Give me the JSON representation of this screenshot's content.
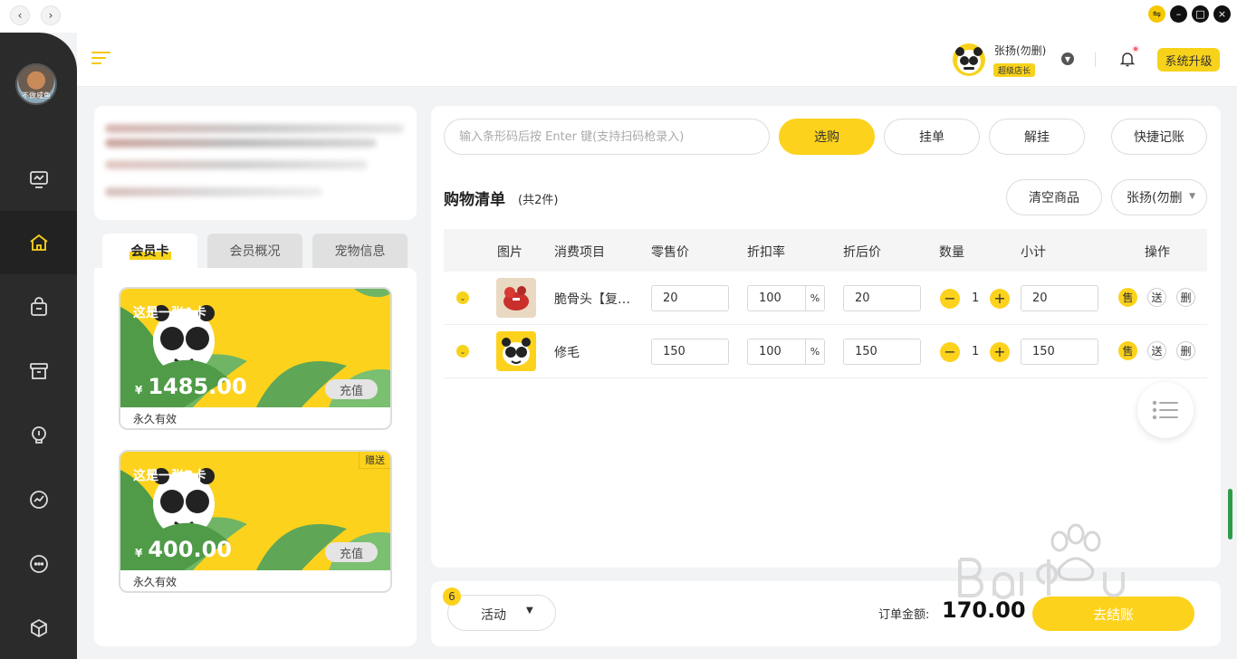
{
  "titlebar": {
    "back_glyph": "‹",
    "forward_glyph": "›",
    "controls": [
      "⇋",
      "–",
      "□",
      "×"
    ]
  },
  "sidebar": {
    "avatar_caption": "不做咸鱼",
    "items": [
      {
        "icon": "monitor-icon",
        "active": false
      },
      {
        "icon": "shop-icon",
        "active": true
      },
      {
        "icon": "bag-icon",
        "active": false
      },
      {
        "icon": "box-icon",
        "active": false
      },
      {
        "icon": "bulb-icon",
        "active": false
      },
      {
        "icon": "chart-icon",
        "active": false
      },
      {
        "icon": "chat-icon",
        "active": false
      },
      {
        "icon": "cube-icon",
        "active": false
      }
    ]
  },
  "header": {
    "user_name": "张扬(勿删)",
    "user_role": "超级店长",
    "upgrade_label": "系统升级"
  },
  "member_tabs": [
    "会员卡",
    "会员概况",
    "宠物信息"
  ],
  "cards": [
    {
      "title": "这是一张A卡",
      "currency": "¥",
      "amount": "1485.00",
      "recharge": "充值",
      "validity": "永久有效",
      "gift": ""
    },
    {
      "title": "这是一张B卡",
      "currency": "¥",
      "amount": "400.00",
      "recharge": "充值",
      "validity": "永久有效",
      "gift": "赠送"
    }
  ],
  "toolbar": {
    "barcode_placeholder": "输入条形码后按 Enter 键(支持扫码枪录入)",
    "select_label": "选购",
    "hold_label": "挂单",
    "unhold_label": "解挂",
    "quick_label": "快捷记账"
  },
  "shopping": {
    "title": "购物清单",
    "count": "(共2件)",
    "clear_label": "清空商品",
    "staff_select": "张扬(勿删"
  },
  "table": {
    "headers": [
      "图片",
      "消费项目",
      "零售价",
      "折扣率",
      "折后价",
      "数量",
      "小计",
      "操作"
    ],
    "rows": [
      {
        "name": "脆骨头【复合】",
        "retail": "20",
        "discount": "100",
        "pct": "%",
        "after": "20",
        "qty": "1",
        "subtotal": "20",
        "ops": [
          "售",
          "送",
          "删"
        ]
      },
      {
        "name": "修毛",
        "retail": "150",
        "discount": "100",
        "pct": "%",
        "after": "150",
        "qty": "1",
        "subtotal": "150",
        "ops": [
          "售",
          "送",
          "删"
        ]
      }
    ],
    "minus": "−",
    "plus": "+"
  },
  "bottom": {
    "activity_badge": "6",
    "activity_label": "活动",
    "order_label": "订单金额:",
    "order_amount": "170.00",
    "checkout_label": "去结账"
  },
  "colors": {
    "accent": "#fcd21d",
    "sidebar": "#2b2b2b",
    "background": "#f2f3f5"
  }
}
